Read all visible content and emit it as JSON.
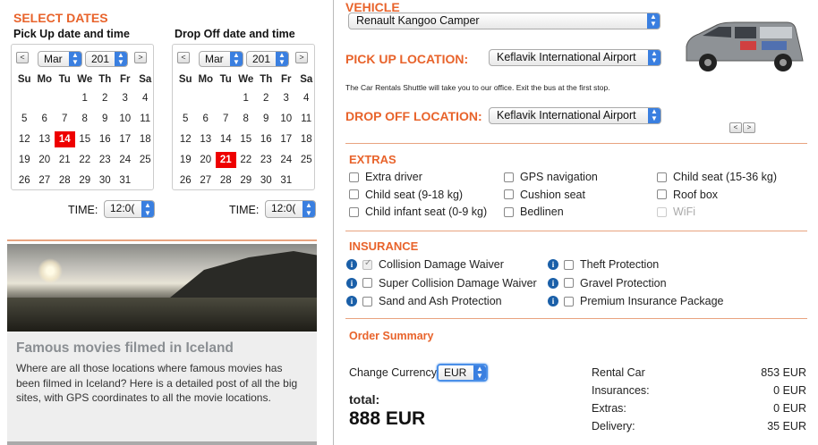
{
  "select_dates": {
    "title": "SELECT DATES",
    "pickup": {
      "label": "Pick Up date and time",
      "month": "Mar",
      "year": "201",
      "selected_day": "14",
      "time_label": "TIME:",
      "time": "12:0("
    },
    "dropoff": {
      "label": "Drop Off date and time",
      "month": "Mar",
      "year": "201",
      "selected_day": "21",
      "time_label": "TIME:",
      "time": "12:0("
    },
    "weekdays": [
      "Su",
      "Mo",
      "Tu",
      "We",
      "Th",
      "Fr",
      "Sa"
    ],
    "weeks": [
      [
        "",
        "",
        "",
        "",
        "1",
        "2",
        "3"
      ],
      [
        "4",
        "5",
        "6",
        "7",
        "8",
        "9",
        "10"
      ],
      [
        "11",
        "12",
        "13",
        "14",
        "15",
        "16",
        "17"
      ],
      [
        "18",
        "19",
        "20",
        "21",
        "22",
        "23",
        "24"
      ],
      [
        "25",
        "26",
        "27",
        "28",
        "29",
        "30",
        "31"
      ]
    ],
    "weeks_display": [
      [
        "",
        "",
        "",
        "1",
        "2",
        "3",
        "4"
      ],
      [
        "5",
        "6",
        "7",
        "8",
        "9",
        "10",
        "11"
      ],
      [
        "12",
        "13",
        "14",
        "15",
        "16",
        "17",
        "18"
      ],
      [
        "19",
        "20",
        "21",
        "22",
        "23",
        "24",
        "25"
      ],
      [
        "26",
        "27",
        "28",
        "29",
        "30",
        "31",
        ""
      ]
    ],
    "prev_symbol": "<",
    "next_symbol": ">"
  },
  "article": {
    "title": "Famous movies filmed in Iceland",
    "text": "Where are all those locations where famous movies has been filmed in Iceland? Here is a detailed post of all the big sites, with GPS coordinates to all the movie locations."
  },
  "vehicle": {
    "title": "VEHICLE",
    "selected": "Renault Kangoo Camper"
  },
  "pickup_location": {
    "title": "PICK UP LOCATION:",
    "selected": "Keflavik International Airport",
    "note": "The Car Rentals Shuttle will take you to our office. Exit the bus at the first stop."
  },
  "dropoff_location": {
    "title": "DROP OFF LOCATION:",
    "selected": "Keflavik International Airport"
  },
  "extras": {
    "title": "EXTRAS",
    "items": [
      {
        "label": "Extra driver",
        "disabled": false
      },
      {
        "label": "GPS navigation",
        "disabled": false
      },
      {
        "label": "Child seat (15-36 kg)",
        "disabled": false
      },
      {
        "label": "Child seat (9-18 kg)",
        "disabled": false
      },
      {
        "label": "Cushion seat",
        "disabled": false
      },
      {
        "label": "Roof box",
        "disabled": false
      },
      {
        "label": "Child infant seat (0-9 kg)",
        "disabled": false
      },
      {
        "label": "Bedlinen",
        "disabled": false
      },
      {
        "label": "WiFi",
        "disabled": true
      }
    ]
  },
  "insurance": {
    "title": "INSURANCE",
    "items": [
      {
        "label": "Collision Damage Waiver",
        "checked": true
      },
      {
        "label": "Theft Protection",
        "checked": false
      },
      {
        "label": "Super Collision Damage Waiver",
        "checked": false
      },
      {
        "label": "Gravel Protection",
        "checked": false
      },
      {
        "label": "Sand and Ash Protection",
        "checked": false
      },
      {
        "label": "Premium Insurance Package",
        "checked": false
      }
    ],
    "info_symbol": "i"
  },
  "order_summary": {
    "title": "Order Summary",
    "currency_label": "Change Currency",
    "currency": "EUR",
    "total_label": "total:",
    "total_value": "888 EUR",
    "rows": [
      {
        "label": "Rental Car",
        "value": "853 EUR"
      },
      {
        "label": "Insurances:",
        "value": "0 EUR"
      },
      {
        "label": "Extras:",
        "value": "0 EUR"
      },
      {
        "label": "Delivery:",
        "value": "35 EUR"
      }
    ]
  },
  "colors": {
    "accent": "#e8632b",
    "selected_day": "#ee0000",
    "select_arrow": "#3a7fe0",
    "info_icon": "#1a5fa8"
  }
}
